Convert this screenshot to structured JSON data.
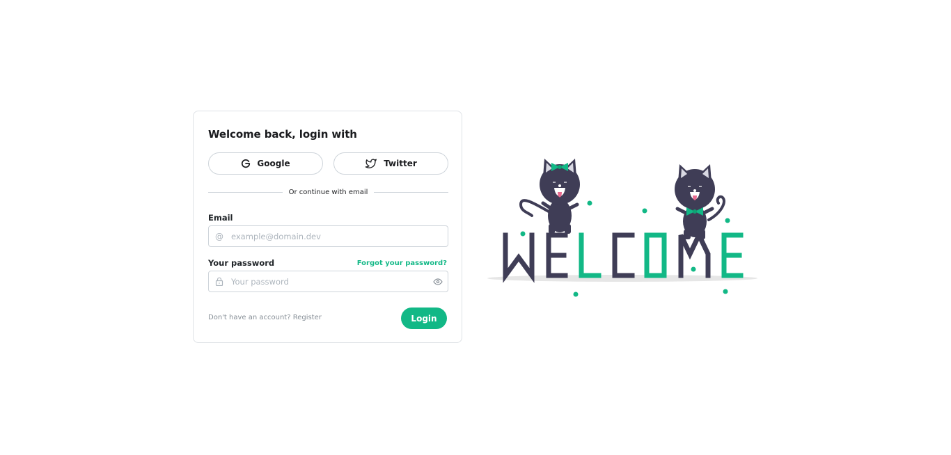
{
  "form": {
    "title": "Welcome back, login with",
    "google_label": "Google",
    "twitter_label": "Twitter",
    "divider_text": "Or continue with email",
    "email_label": "Email",
    "email_placeholder": "example@domain.dev",
    "email_value": "",
    "password_label": "Your password",
    "password_placeholder": "Your password",
    "password_value": "",
    "forgot_link": "Forgot your password?",
    "register_link": "Don't have an account? Register",
    "login_button": "Login"
  },
  "illustration": {
    "letters": [
      "W",
      "E",
      "L",
      "C",
      "O",
      "M",
      "E"
    ]
  },
  "icons": {
    "google": "google-icon",
    "twitter": "twitter-icon",
    "email": "at-icon",
    "password": "lock-icon",
    "visibility": "eye-icon"
  },
  "colors": {
    "accent": "#12b886",
    "dark": "#3f3d56",
    "border": "#ced4da",
    "muted": "#868e96",
    "placeholder": "#adb5bd"
  }
}
